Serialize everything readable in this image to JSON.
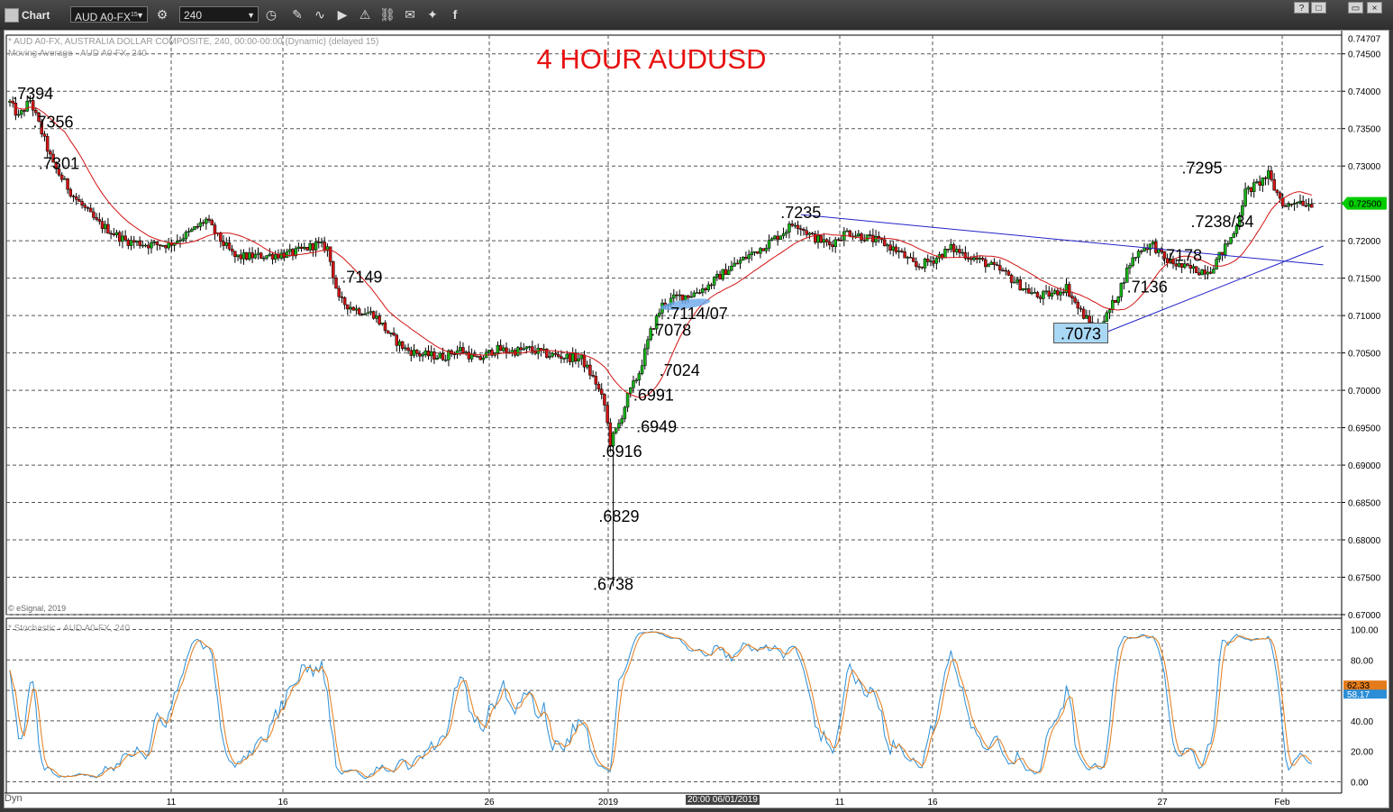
{
  "toolbar": {
    "chart_label": "Chart",
    "symbol": "AUD A0-FX",
    "symbol_sup": "15",
    "interval": "240",
    "win_buttons": [
      "?",
      "□",
      "▭",
      "×"
    ]
  },
  "header": {
    "line1": "* AUD A0-FX, AUSTRALIA DOLLAR COMPOSITE, 240, 00:00-00:00 (Dynamic) (delayed 15)",
    "line2": "Moving Average - AUD A0-FX, 240",
    "copyright": "© eSignal, 2019",
    "stoch_label": "* Stochastic - AUD A0-FX, 240",
    "dyn_label": "Dyn",
    "cursor_date": "20:00 06/01/2019"
  },
  "colors": {
    "up": "#17b217",
    "down": "#d21414",
    "ma": "#d21414",
    "trend": "#2323c8",
    "title": "#e81010",
    "stoch_k": "#2b8ed6",
    "stoch_d": "#e47b1a",
    "price_tag": "#00cc00"
  },
  "chart_data": {
    "type": "candlestick",
    "title": "4 HOUR AUDUSD",
    "ylim": [
      0.67,
      0.7475
    ],
    "y_ticks": [
      "0.74500",
      "0.74000",
      "0.73500",
      "0.73000",
      "0.72500",
      "0.72000",
      "0.71500",
      "0.71000",
      "0.70500",
      "0.70000",
      "0.69500",
      "0.69000",
      "0.68500",
      "0.68000",
      "0.67500",
      "0.67000"
    ],
    "y_top_label": "0.74707",
    "last_price": "0.72500",
    "x_labels": [
      "11",
      "16",
      "26",
      "2019",
      "11",
      "16",
      "27",
      "Feb"
    ],
    "price_path": [
      [
        0,
        0.7385
      ],
      [
        3,
        0.7365
      ],
      [
        7,
        0.7388
      ],
      [
        10,
        0.7356
      ],
      [
        15,
        0.7301
      ],
      [
        22,
        0.726
      ],
      [
        30,
        0.7225
      ],
      [
        40,
        0.72
      ],
      [
        48,
        0.7195
      ],
      [
        55,
        0.7195
      ],
      [
        62,
        0.721
      ],
      [
        68,
        0.7228
      ],
      [
        72,
        0.7205
      ],
      [
        78,
        0.7178
      ],
      [
        88,
        0.718
      ],
      [
        98,
        0.7183
      ],
      [
        106,
        0.7195
      ],
      [
        110,
        0.719
      ],
      [
        114,
        0.712
      ],
      [
        120,
        0.7108
      ],
      [
        126,
        0.7102
      ],
      [
        132,
        0.7072
      ],
      [
        137,
        0.7055
      ],
      [
        142,
        0.7048
      ],
      [
        150,
        0.7045
      ],
      [
        156,
        0.7055
      ],
      [
        162,
        0.704
      ],
      [
        168,
        0.7055
      ],
      [
        174,
        0.7052
      ],
      [
        180,
        0.7055
      ],
      [
        186,
        0.7048
      ],
      [
        192,
        0.7045
      ],
      [
        198,
        0.7042
      ],
      [
        203,
        0.701
      ],
      [
        206,
        0.698
      ],
      [
        208,
        0.693
      ],
      [
        211,
        0.6955
      ],
      [
        214,
        0.6991
      ],
      [
        218,
        0.7024
      ],
      [
        222,
        0.7078
      ],
      [
        226,
        0.7114
      ],
      [
        231,
        0.7125
      ],
      [
        236,
        0.7128
      ],
      [
        242,
        0.714
      ],
      [
        248,
        0.716
      ],
      [
        255,
        0.7178
      ],
      [
        262,
        0.7195
      ],
      [
        268,
        0.7212
      ],
      [
        272,
        0.7225
      ],
      [
        278,
        0.7205
      ],
      [
        284,
        0.7195
      ],
      [
        290,
        0.7212
      ],
      [
        296,
        0.7205
      ],
      [
        302,
        0.7198
      ],
      [
        308,
        0.7185
      ],
      [
        314,
        0.7165
      ],
      [
        320,
        0.7175
      ],
      [
        326,
        0.719
      ],
      [
        332,
        0.718
      ],
      [
        338,
        0.717
      ],
      [
        344,
        0.7158
      ],
      [
        350,
        0.714
      ],
      [
        356,
        0.7125
      ],
      [
        362,
        0.713
      ],
      [
        366,
        0.7138
      ],
      [
        370,
        0.711
      ],
      [
        374,
        0.709
      ],
      [
        377,
        0.7083
      ],
      [
        380,
        0.71
      ],
      [
        384,
        0.713
      ],
      [
        388,
        0.717
      ],
      [
        392,
        0.719
      ],
      [
        396,
        0.7195
      ],
      [
        400,
        0.7175
      ],
      [
        406,
        0.7165
      ],
      [
        412,
        0.716
      ],
      [
        416,
        0.7162
      ],
      [
        420,
        0.7185
      ],
      [
        424,
        0.721
      ],
      [
        428,
        0.7265
      ],
      [
        432,
        0.7275
      ],
      [
        436,
        0.7288
      ],
      [
        438,
        0.727
      ],
      [
        442,
        0.7245
      ],
      [
        446,
        0.7255
      ],
      [
        449,
        0.725
      ]
    ],
    "wick_extremes": [
      {
        "bar": 209,
        "low": 0.6738
      }
    ],
    "ma_period": 20,
    "trend_lines": [
      {
        "from": [
          274,
          0.7235
        ],
        "to": [
          449,
          0.717
        ],
        "extend_to": 455
      },
      {
        "from": [
          378,
          0.7075
        ],
        "to": [
          440,
          0.717
        ],
        "extend_to": 455
      }
    ],
    "annotations": [
      {
        "text": ".7394",
        "bar": 8,
        "price": 0.7394
      },
      {
        "text": ".7356",
        "bar": 15,
        "price": 0.7356
      },
      {
        "text": ".7301",
        "bar": 17,
        "price": 0.7301
      },
      {
        "text": ".7149",
        "bar": 122,
        "price": 0.7149
      },
      {
        "text": ".7114/07",
        "bar": 238,
        "price": 0.71
      },
      {
        "text": ".7078",
        "bar": 229,
        "price": 0.7078
      },
      {
        "text": ".7024",
        "bar": 232,
        "price": 0.7024
      },
      {
        "text": ".6991",
        "bar": 223,
        "price": 0.6991
      },
      {
        "text": ".6949",
        "bar": 224,
        "price": 0.6949
      },
      {
        "text": ".6916",
        "bar": 212,
        "price": 0.6916
      },
      {
        "text": ".6829",
        "bar": 211,
        "price": 0.6829
      },
      {
        "text": ".6738",
        "bar": 209,
        "price": 0.6738
      },
      {
        "text": ".7235",
        "bar": 274,
        "price": 0.7235
      },
      {
        "text": ".7073",
        "bar": 371,
        "price": 0.7073,
        "boxed": true
      },
      {
        "text": ".7136",
        "bar": 394,
        "price": 0.7136
      },
      {
        "text": ".7178",
        "bar": 406,
        "price": 0.7178
      },
      {
        "text": ".7238/34",
        "bar": 420,
        "price": 0.7223
      },
      {
        "text": ".7295",
        "bar": 413,
        "price": 0.7295
      }
    ],
    "stochastic": {
      "ylim": [
        -5,
        105
      ],
      "ticks": [
        "100.00",
        "80.00",
        "60.00",
        "40.00",
        "20.00",
        "0.00"
      ],
      "last_k": "58.17",
      "last_d": "62.33"
    }
  }
}
